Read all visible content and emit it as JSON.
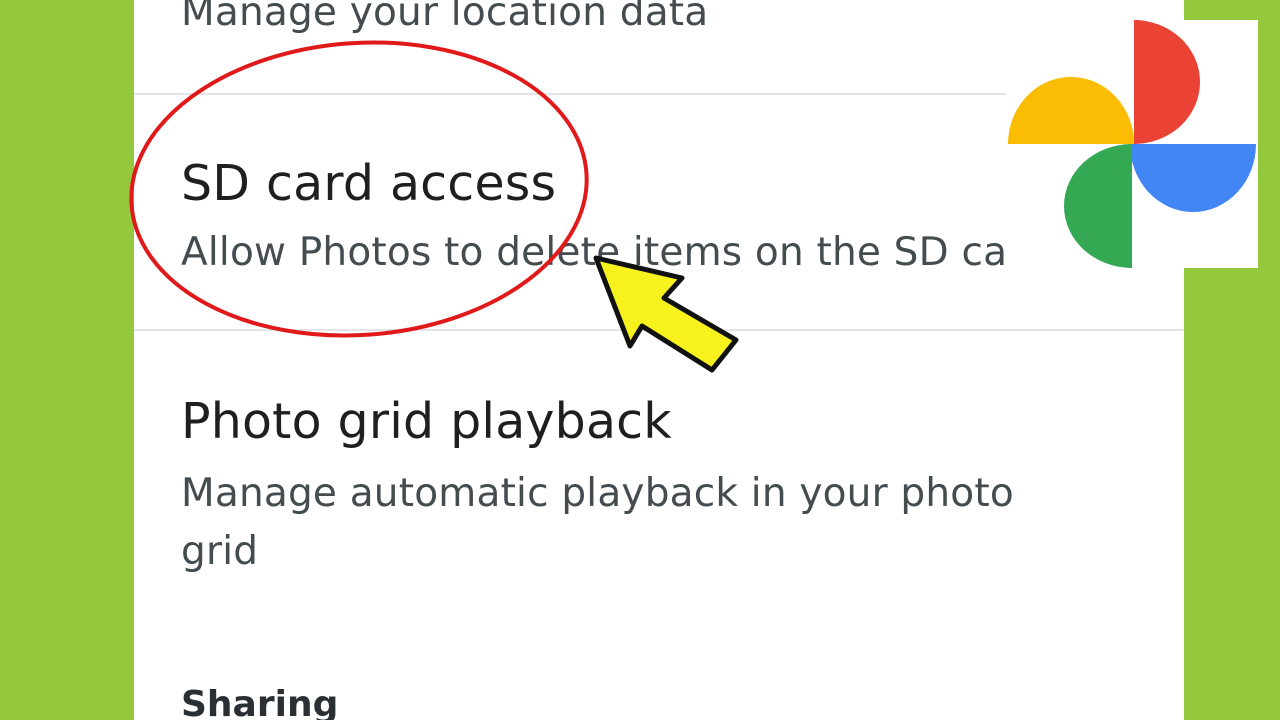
{
  "settings": {
    "location": {
      "subtitle": "Manage your location data"
    },
    "sd_card": {
      "title": "SD card access",
      "subtitle": "Allow Photos to delete items on the SD card"
    },
    "photo_grid": {
      "title": "Photo grid playback",
      "subtitle": "Manage automatic playback in your photo grid"
    },
    "sharing_header": "Sharing"
  },
  "overlay": {
    "highlight_color": "#e01a1a",
    "arrow_fill": "#f7f21e",
    "arrow_outline": "#111111",
    "logo_name": "google-photos-logo",
    "logo_colors": {
      "red": "#ea4335",
      "yellow": "#fbbc04",
      "green": "#34a853",
      "blue": "#4285f4"
    }
  },
  "colors": {
    "background": "#94c93e",
    "screen": "#ffffff",
    "title_text": "#1f1f1f",
    "subtitle_text": "#444c50",
    "divider": "#e3e5e8"
  }
}
